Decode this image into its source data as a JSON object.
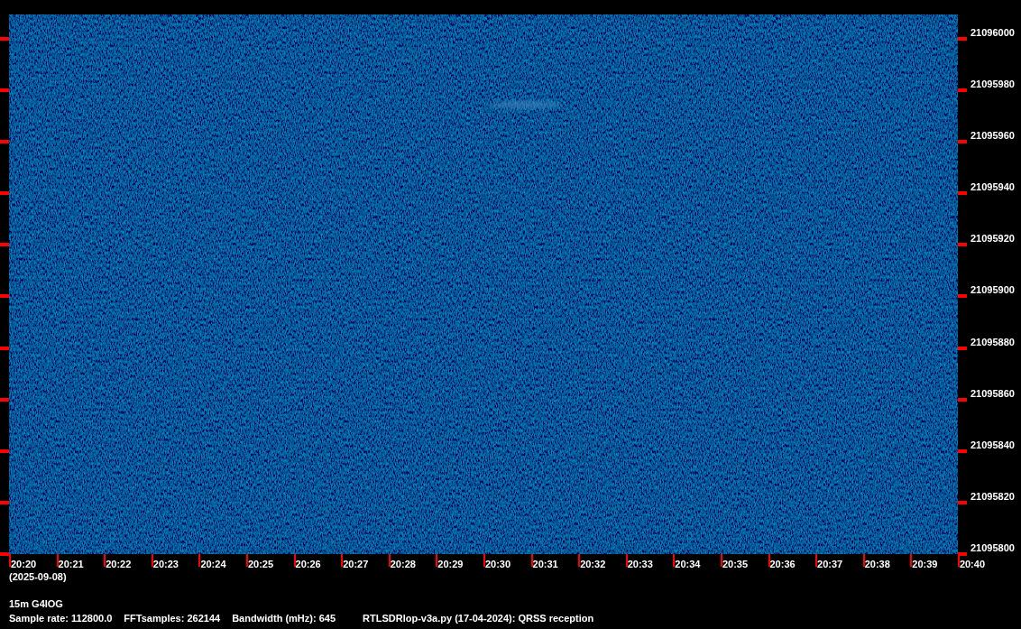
{
  "spectrogram": {
    "frequency_labels": [
      "21096000",
      "21095980",
      "21095960",
      "21095940",
      "21095920",
      "21095900",
      "21095880",
      "21095860",
      "21095840",
      "21095820",
      "21095800"
    ],
    "time_labels": [
      "20:20",
      "20:21",
      "20:22",
      "20:23",
      "20:24",
      "20:25",
      "20:26",
      "20:27",
      "20:28",
      "20:29",
      "20:30",
      "20:31",
      "20:32",
      "20:33",
      "20:34",
      "20:35",
      "20:36",
      "20:37",
      "20:38",
      "20:39",
      "20:40"
    ],
    "date": "(2025-09-08)"
  },
  "station": "15m G4IOG",
  "info": [
    "Sample rate: 112800.0",
    "FFTsamples: 262144",
    "Bandwidth (mHz): 645",
    "RTLSDRlop-v3a.py (17-04-2024): QRSS reception"
  ]
}
